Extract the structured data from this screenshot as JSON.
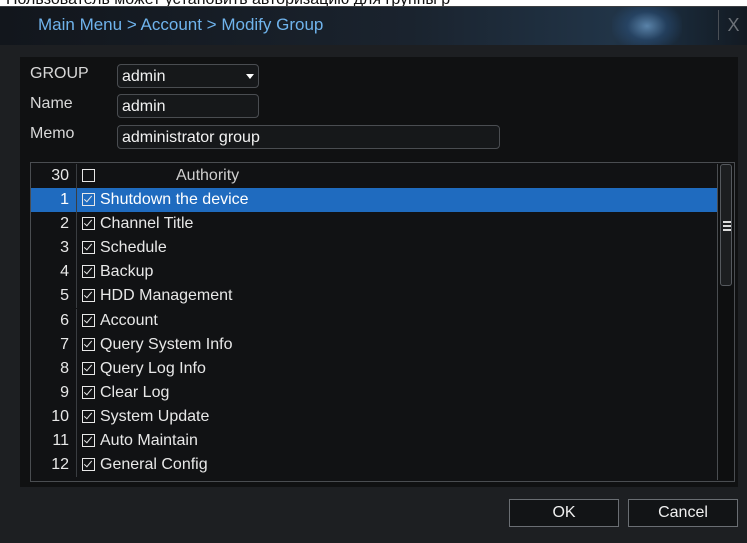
{
  "background_text": "Пользователь может установить авторизацию для группы р",
  "dialog": {
    "title": "Main Menu > Account > Modify Group",
    "close_label": "X"
  },
  "form": {
    "group_label": "GROUP",
    "group_value": "admin",
    "name_label": "Name",
    "name_value": "admin",
    "memo_label": "Memo",
    "memo_value": "administrator group"
  },
  "authority_list": {
    "header_count": "30",
    "header_label": "Authority",
    "selected_index": 0,
    "rows": [
      {
        "num": "1",
        "label": "Shutdown the device",
        "checked": true
      },
      {
        "num": "2",
        "label": "Channel Title",
        "checked": true
      },
      {
        "num": "3",
        "label": "Schedule",
        "checked": true
      },
      {
        "num": "4",
        "label": "Backup",
        "checked": true
      },
      {
        "num": "5",
        "label": "HDD Management",
        "checked": true
      },
      {
        "num": "6",
        "label": "Account",
        "checked": true
      },
      {
        "num": "7",
        "label": "Query System Info",
        "checked": true
      },
      {
        "num": "8",
        "label": "Query Log Info",
        "checked": true
      },
      {
        "num": "9",
        "label": "Clear Log",
        "checked": true
      },
      {
        "num": "10",
        "label": "System Update",
        "checked": true
      },
      {
        "num": "11",
        "label": "Auto Maintain",
        "checked": true
      },
      {
        "num": "12",
        "label": "General Config",
        "checked": true
      }
    ]
  },
  "buttons": {
    "ok_label": "OK",
    "cancel_label": "Cancel"
  },
  "colors": {
    "title_text": "#6fb3ec",
    "selection": "#1f6bbf",
    "panel": "#101112",
    "dialog": "#1d1f22"
  }
}
